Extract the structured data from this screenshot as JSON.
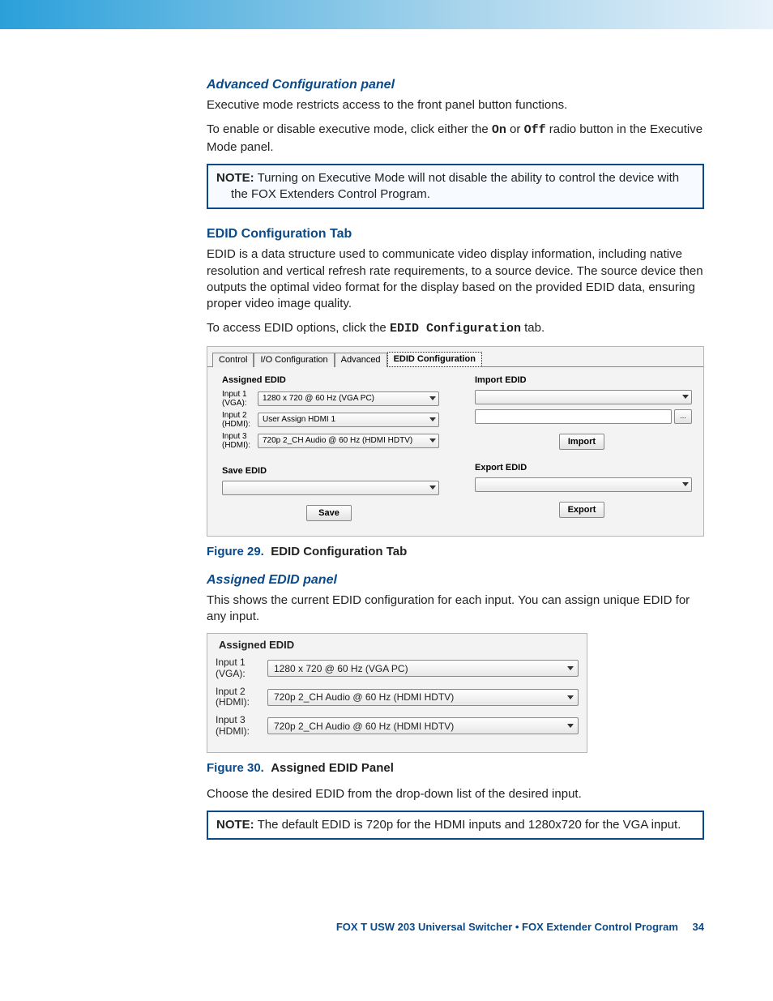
{
  "section1": {
    "heading": "Advanced Configuration panel",
    "p1": "Executive mode restricts access to the front panel button functions.",
    "p2_pre": "To enable or disable executive mode,  click either the ",
    "p2_on": "On",
    "p2_mid": " or ",
    "p2_off": "Off",
    "p2_post": " radio button in the Executive Mode panel.",
    "note_label": "NOTE:",
    "note_text": "Turning on Executive Mode will not disable the ability to control the device with the FOX Extenders Control Program."
  },
  "section2": {
    "heading": "EDID Configuration Tab",
    "p1": "EDID is a data structure used to communicate video display information, including native resolution and vertical refresh rate requirements, to a source device. The source device then outputs the optimal video format for the display based on the provided EDID data, ensuring proper video image quality.",
    "p2_pre": "To access EDID options, click the ",
    "p2_mono": "EDID Configuration",
    "p2_post": " tab."
  },
  "panel1": {
    "tabs": [
      "Control",
      "I/O Configuration",
      "Advanced",
      "EDID Configuration"
    ],
    "assigned_title": "Assigned EDID",
    "import_title": "Import EDID",
    "save_title": "Save EDID",
    "export_title": "Export EDID",
    "inputs": [
      {
        "label": "Input 1 (VGA):",
        "value": "1280 x 720 @ 60 Hz (VGA PC)"
      },
      {
        "label": "Input 2 (HDMI):",
        "value": "User Assign HDMI 1"
      },
      {
        "label": "Input 3 (HDMI):",
        "value": "720p 2_CH Audio @ 60 Hz (HDMI HDTV)"
      }
    ],
    "browse": "...",
    "import_btn": "Import",
    "save_btn": "Save",
    "export_btn": "Export"
  },
  "fig29": {
    "label": "Figure 29.",
    "title": "EDID Configuration Tab"
  },
  "section3": {
    "heading": "Assigned EDID panel",
    "p1": "This shows the current EDID configuration for each input. You can assign unique EDID for any input."
  },
  "panel2": {
    "title": "Assigned EDID",
    "inputs": [
      {
        "label": "Input 1 (VGA):",
        "value": "1280 x 720 @ 60 Hz (VGA PC)"
      },
      {
        "label": "Input 2 (HDMI):",
        "value": "720p 2_CH Audio @ 60 Hz (HDMI HDTV)"
      },
      {
        "label": "Input 3 (HDMI):",
        "value": "720p 2_CH Audio @ 60 Hz (HDMI HDTV)"
      }
    ]
  },
  "fig30": {
    "label": "Figure 30.",
    "title": "Assigned EDID Panel"
  },
  "section4": {
    "p1": "Choose the desired EDID from the drop-down list of the desired input.",
    "note_label": "NOTE:",
    "note_text": "The default EDID is 720p for the HDMI inputs and 1280x720 for the VGA input."
  },
  "footer": {
    "text": "FOX T USW 203 Universal Switcher • FOX Extender Control Program",
    "page": "34"
  }
}
